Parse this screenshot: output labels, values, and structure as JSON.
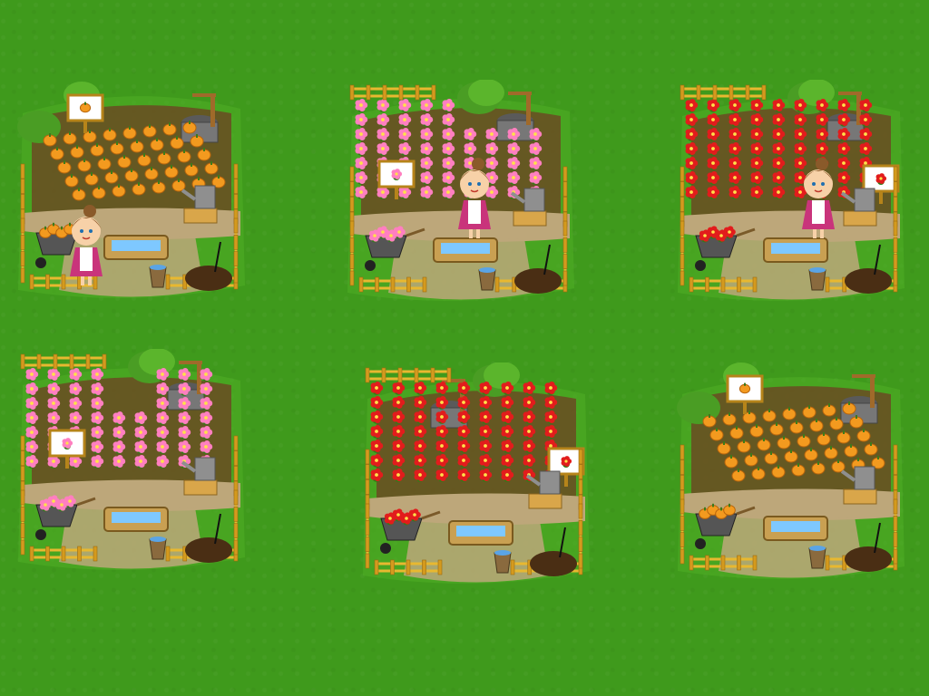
{
  "scene": {
    "background_color": "#3f9a1c",
    "plots": [
      {
        "id": "plot-1",
        "crop": "pumpkin",
        "layout": "diagonal",
        "has_farmer": true,
        "wheelbarrow_load": "pumpkin",
        "sign_icon": "pumpkin-icon"
      },
      {
        "id": "plot-2",
        "crop": "pink-flower",
        "layout": "grid",
        "has_farmer": true,
        "wheelbarrow_load": "pink-flower",
        "sign_icon": "pink-flower-icon"
      },
      {
        "id": "plot-3",
        "crop": "red-flower",
        "layout": "grid",
        "has_farmer": true,
        "wheelbarrow_load": "red-flower",
        "sign_icon": "red-flower-icon"
      },
      {
        "id": "plot-4",
        "crop": "pink-flower",
        "layout": "grid",
        "has_farmer": false,
        "wheelbarrow_load": "pink-flower",
        "sign_icon": "pink-flower-icon"
      },
      {
        "id": "plot-5",
        "crop": "red-flower",
        "layout": "grid",
        "has_farmer": false,
        "wheelbarrow_load": "red-flower",
        "sign_icon": "red-flower-icon"
      },
      {
        "id": "plot-6",
        "crop": "pumpkin",
        "layout": "diagonal",
        "has_farmer": false,
        "wheelbarrow_load": "pumpkin",
        "sign_icon": "pumpkin-icon"
      }
    ],
    "colors": {
      "pumpkin": "#f39a1f",
      "pink_flower": "#ff7fc0",
      "red_flower": "#e21c1c",
      "fence": "#e8b830",
      "soil": "#6b4a22",
      "path": "#bda77a",
      "water": "#7ec8ff",
      "dress": "#c9347b"
    }
  }
}
